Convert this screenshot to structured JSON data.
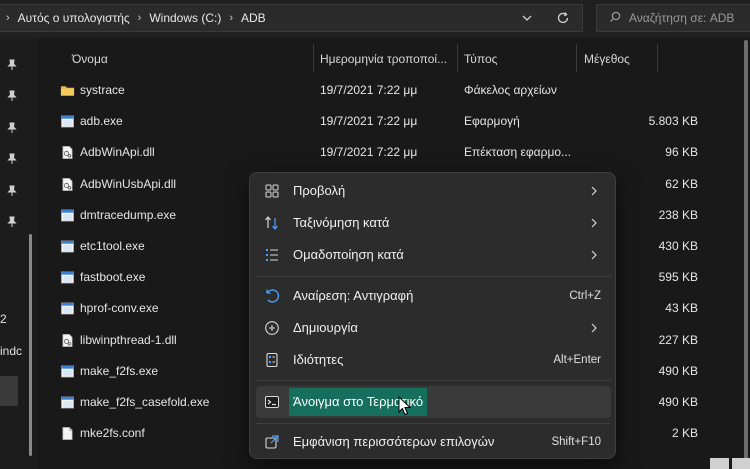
{
  "breadcrumb": {
    "items": [
      "Αυτός ο υπολογιστής",
      "Windows (C:)",
      "ADB"
    ]
  },
  "search": {
    "placeholder": "Αναζήτηση σε: ADB"
  },
  "nav": {
    "partial_labels": [
      "2",
      "indc"
    ]
  },
  "columns": {
    "name": "Όνομα",
    "date": "Ημερομηνία τροποποί...",
    "type": "Τύπος",
    "size": "Μέγεθος"
  },
  "files": [
    {
      "name": "systrace",
      "date": "19/7/2021 7:22 μμ",
      "type": "Φάκελος αρχείων",
      "size": "",
      "icon": "folder"
    },
    {
      "name": "adb.exe",
      "date": "19/7/2021 7:22 μμ",
      "type": "Εφαρμογή",
      "size": "5.803 KB",
      "icon": "exe"
    },
    {
      "name": "AdbWinApi.dll",
      "date": "19/7/2021 7:22 μμ",
      "type": "Επέκταση εφαρμο...",
      "size": "96 KB",
      "icon": "dll"
    },
    {
      "name": "AdbWinUsbApi.dll",
      "date": "",
      "type": "",
      "size": "62 KB",
      "icon": "dll"
    },
    {
      "name": "dmtracedump.exe",
      "date": "",
      "type": "",
      "size": "238 KB",
      "icon": "exe"
    },
    {
      "name": "etc1tool.exe",
      "date": "",
      "type": "",
      "size": "430 KB",
      "icon": "exe"
    },
    {
      "name": "fastboot.exe",
      "date": "",
      "type": "",
      "size": "595 KB",
      "icon": "exe"
    },
    {
      "name": "hprof-conv.exe",
      "date": "",
      "type": "",
      "size": "43 KB",
      "icon": "exe"
    },
    {
      "name": "libwinpthread-1.dll",
      "date": "",
      "type": "",
      "size": "227 KB",
      "icon": "dll"
    },
    {
      "name": "make_f2fs.exe",
      "date": "",
      "type": "",
      "size": "490 KB",
      "icon": "exe"
    },
    {
      "name": "make_f2fs_casefold.exe",
      "date": "",
      "type": "",
      "size": "490 KB",
      "icon": "exe"
    },
    {
      "name": "mke2fs.conf",
      "date": "",
      "type": "",
      "size": "2 KB",
      "icon": "file"
    }
  ],
  "context_menu": {
    "items": [
      {
        "label": "Προβολή",
        "shortcut": "",
        "submenu": true,
        "icon": "view-grid-icon"
      },
      {
        "label": "Ταξινόμηση κατά",
        "shortcut": "",
        "submenu": true,
        "icon": "sort-icon"
      },
      {
        "label": "Ομαδοποίηση κατά",
        "shortcut": "",
        "submenu": true,
        "icon": "group-icon"
      },
      {
        "label": "Αναίρεση: Αντιγραφή",
        "shortcut": "Ctrl+Z",
        "submenu": false,
        "icon": "undo-icon"
      },
      {
        "label": "Δημιουργία",
        "shortcut": "",
        "submenu": true,
        "icon": "new-icon"
      },
      {
        "label": "Ιδιότητες",
        "shortcut": "Alt+Enter",
        "submenu": false,
        "icon": "properties-icon"
      },
      {
        "label": "Άνοιγμα στο Τερματικό",
        "shortcut": "",
        "submenu": false,
        "icon": "terminal-icon"
      },
      {
        "label": "Εμφάνιση περισσότερων επιλογών",
        "shortcut": "Shift+F10",
        "submenu": false,
        "icon": "more-options-icon"
      }
    ]
  },
  "colors": {
    "background": "#191919",
    "menu_background": "#2c2c2c",
    "highlight": "#166e5d",
    "accent_blue": "#4aa3ff"
  }
}
